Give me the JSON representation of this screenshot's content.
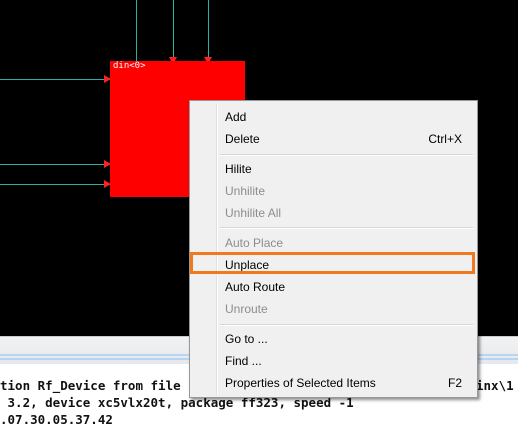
{
  "block": {
    "label": "din<0>",
    "fill_color": "#ff0000"
  },
  "wire_color": "#27b0a8",
  "menu": {
    "items": [
      {
        "label": "Add",
        "shortcut": "",
        "enabled": true
      },
      {
        "label": "Delete",
        "shortcut": "Ctrl+X",
        "enabled": true
      },
      {
        "label": "Hilite",
        "shortcut": "",
        "enabled": true
      },
      {
        "label": "Unhilite",
        "shortcut": "",
        "enabled": false
      },
      {
        "label": "Unhilite All",
        "shortcut": "",
        "enabled": false
      },
      {
        "label": "Auto Place",
        "shortcut": "",
        "enabled": false
      },
      {
        "label": "Unplace",
        "shortcut": "",
        "enabled": true
      },
      {
        "label": "Auto Route",
        "shortcut": "",
        "enabled": true
      },
      {
        "label": "Unroute",
        "shortcut": "",
        "enabled": false
      },
      {
        "label": "Go to ...",
        "shortcut": "",
        "enabled": true
      },
      {
        "label": "Find ...",
        "shortcut": "",
        "enabled": true
      },
      {
        "label": "Properties of Selected Items",
        "shortcut": "F2",
        "enabled": true
      }
    ],
    "highlighted_item": "Unplace",
    "highlight_color": "#f07a1d"
  },
  "console": {
    "lines": [
      "tion Rf_Device from file",
      " 3.2, device xc5vlx20t, package ff323, speed -1",
      ".07.30.05.37.42"
    ],
    "line1_right": "inx\\1"
  }
}
